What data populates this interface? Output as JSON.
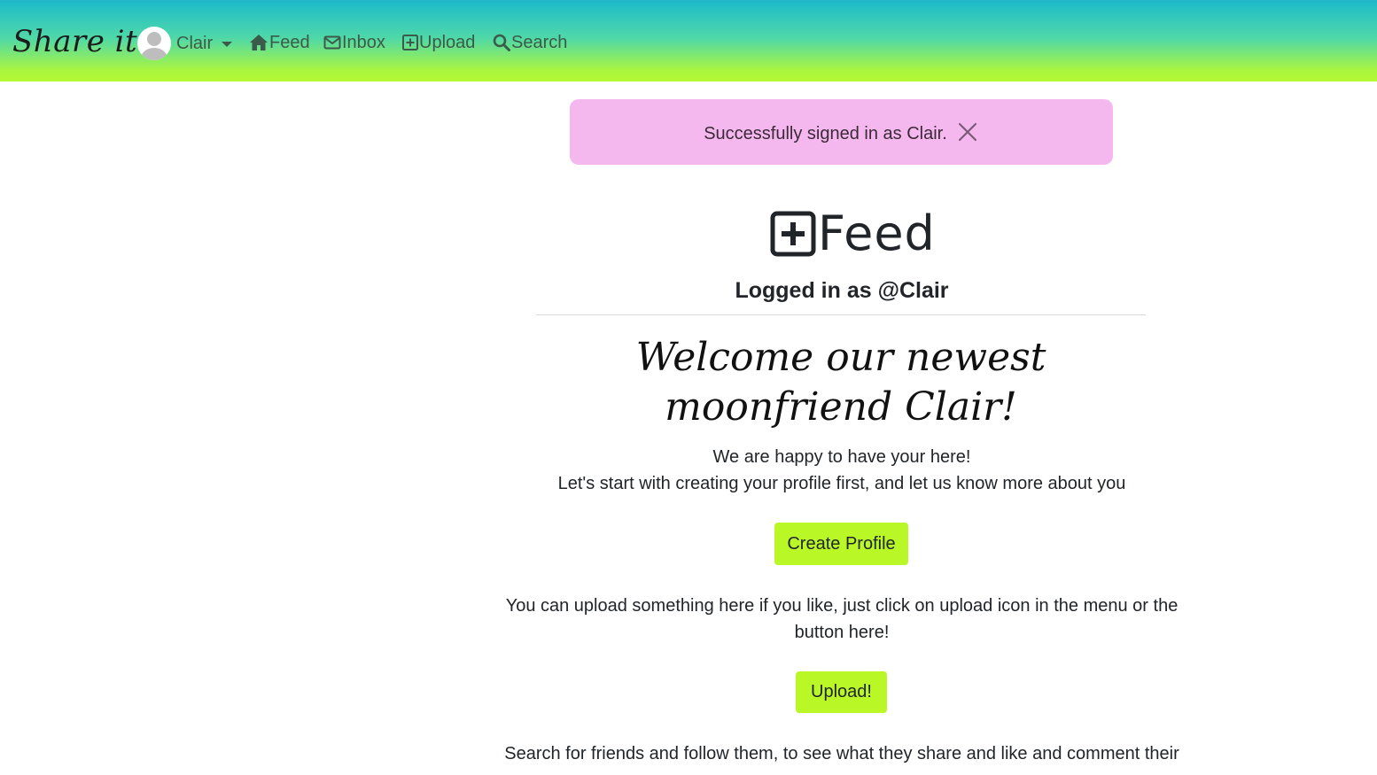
{
  "navbar": {
    "brand": "Share it",
    "user": {
      "name": "Clair",
      "avatar_icon": "user-avatar-icon"
    },
    "links": [
      {
        "label": "Feed",
        "icon": "home-icon"
      },
      {
        "label": "Inbox",
        "icon": "envelope-icon"
      },
      {
        "label": "Upload",
        "icon": "plus-square-icon"
      },
      {
        "label": "Search",
        "icon": "search-icon"
      }
    ],
    "colors": {
      "gradient_top": "#1fbcc9",
      "gradient_bottom": "#b6f832"
    }
  },
  "alert": {
    "message": "Successfully signed in as Clair.",
    "close_icon": "close-icon",
    "background": "#f5b8ee"
  },
  "main": {
    "feed_icon": "plus-square-icon",
    "feed_title": "Feed",
    "logged_in": "Logged in as @Clair",
    "welcome": "Welcome our newest moonfriend Clair!",
    "happy_text": "We are happy to have your here!",
    "profile_text": "Let's start with creating your profile first, and let us know more about you",
    "create_profile_button": "Create Profile",
    "upload_text": "You can upload something here if you like, just click on upload icon in the menu or the button here!",
    "upload_button": "Upload!",
    "search_text": "Search for friends and follow them, to see what they share and like and comment their",
    "button_color": "#b9f826"
  }
}
